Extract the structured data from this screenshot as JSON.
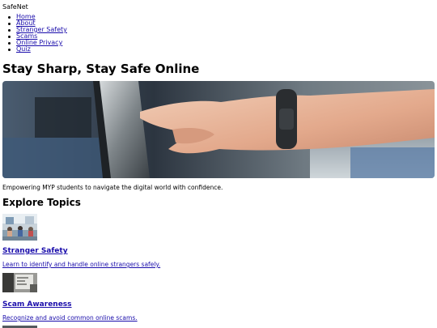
{
  "brand": "SafeNet",
  "nav": {
    "items": [
      {
        "label": "Home"
      },
      {
        "label": "About"
      },
      {
        "label": "Stranger Safety"
      },
      {
        "label": "Scams"
      },
      {
        "label": "Online Privacy"
      },
      {
        "label": "Quiz"
      }
    ]
  },
  "hero": {
    "title": "Stay Sharp, Stay Safe Online",
    "tagline": "Empowering MYP students to navigate the digital world with confidence."
  },
  "topics": {
    "heading": "Explore Topics",
    "items": [
      {
        "title": "Stranger Safety",
        "description": "Learn to identify and handle online strangers safely."
      },
      {
        "title": "Scam Awareness",
        "description": "Recognize and avoid common online scams."
      }
    ]
  },
  "colors": {
    "link": "#1a0dab",
    "text": "#000000",
    "background": "#ffffff"
  }
}
